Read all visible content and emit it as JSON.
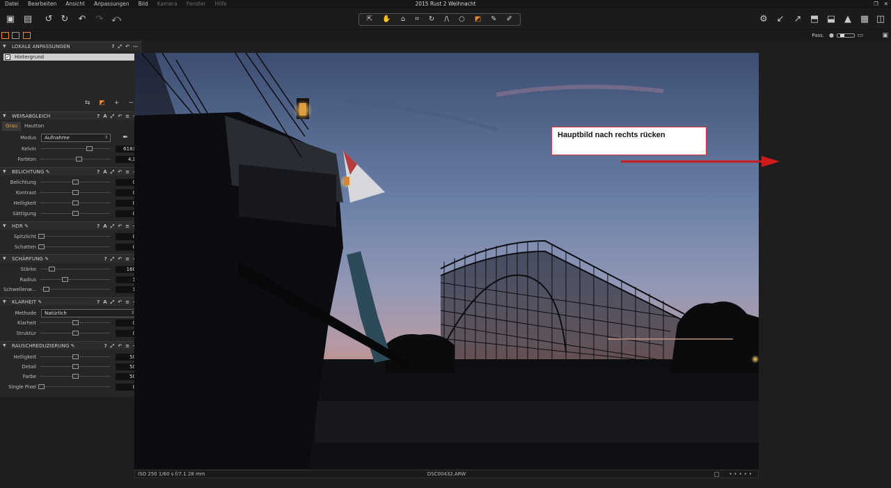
{
  "menu": [
    "Datei",
    "Bearbeiten",
    "Ansicht",
    "Anpassungen",
    "Bild",
    "Kamera",
    "Fenster",
    "Hilfe"
  ],
  "window_title": "2015 Rust 2 Weihnacht",
  "passform": {
    "label": "Pass."
  },
  "layers": {
    "title": "LOKALE ANPASSUNGEN",
    "items": [
      "Hintergrund"
    ]
  },
  "white_balance": {
    "title": "WEIẞABGLEICH",
    "tabs": [
      "Grau",
      "Hautton"
    ],
    "mode_label": "Modus",
    "mode_value": "Aufnahme",
    "kelvin_label": "Kelvin",
    "kelvin_value": "6183",
    "tint_label": "Farbton",
    "tint_value": "4,1"
  },
  "exposure": {
    "title": "BELICHTUNG",
    "rows": [
      {
        "label": "Belichtung",
        "value": "0"
      },
      {
        "label": "Kontrast",
        "value": "0"
      },
      {
        "label": "Helligkeit",
        "value": "0"
      },
      {
        "label": "Sättigung",
        "value": "0"
      }
    ]
  },
  "hdr": {
    "title": "HDR",
    "rows": [
      {
        "label": "Spitzlicht",
        "value": "0"
      },
      {
        "label": "Schatten",
        "value": "0"
      }
    ]
  },
  "sharpening": {
    "title": "SCHÄRFUNG",
    "rows": [
      {
        "label": "Stärke",
        "value": "160"
      },
      {
        "label": "Radius",
        "value": "1"
      },
      {
        "label": "Schwellenw...",
        "value": "1"
      }
    ]
  },
  "clarity": {
    "title": "KLARHEIT",
    "method_label": "Methode",
    "method_value": "Natürlich",
    "rows": [
      {
        "label": "Klarheit",
        "value": "0"
      },
      {
        "label": "Struktur",
        "value": "0"
      }
    ]
  },
  "noise": {
    "title": "RAUSCHREDUZIERUNG",
    "rows": [
      {
        "label": "Helligkeit",
        "value": "50"
      },
      {
        "label": "Detail",
        "value": "50"
      },
      {
        "label": "Farbe",
        "value": "50"
      },
      {
        "label": "Single Pixel",
        "value": "0"
      }
    ]
  },
  "status": {
    "exif": "ISO 250  1/60 s  f/7.1  28 mm",
    "filename": "DSC00432.ARW"
  },
  "annotation": {
    "text": "Hauptbild nach rechts rücken",
    "color": "#d11a1a"
  }
}
